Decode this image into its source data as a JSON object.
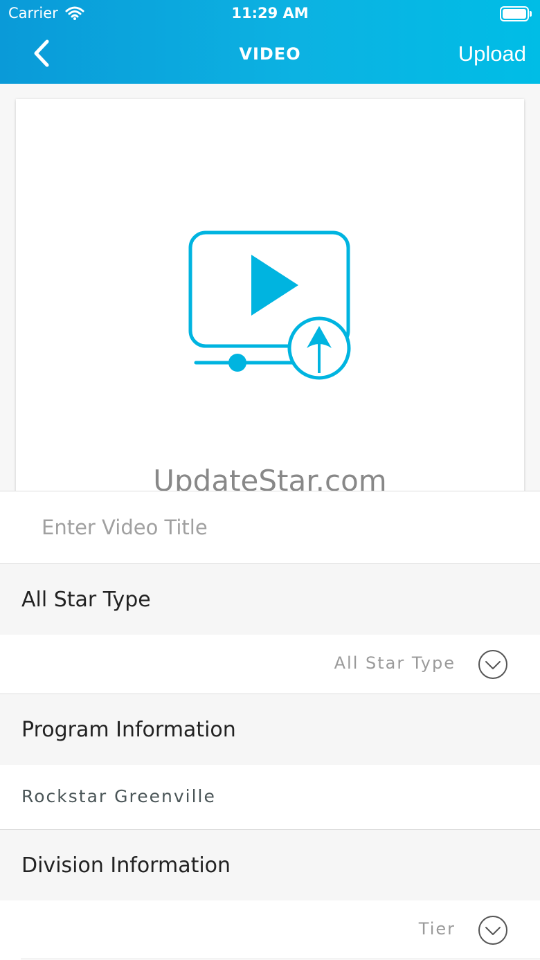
{
  "status_bar": {
    "carrier": "Carrier",
    "time": "11:29 AM"
  },
  "nav": {
    "title": "VIDEO",
    "upload_label": "Upload"
  },
  "video_card": {
    "icon": "video-upload-icon",
    "watermark": "UpdateStar.com"
  },
  "form": {
    "title_placeholder": "Enter Video Title",
    "all_star_type": {
      "label": "All Star Type",
      "picker_value": "All Star Type"
    },
    "program_information": {
      "label": "Program Information",
      "value": "Rockstar Greenville"
    },
    "division_information": {
      "label": "Division Information",
      "picker_value": "Tier"
    }
  },
  "colors": {
    "accent": "#00b4e0",
    "header_start": "#0a9ad8",
    "header_end": "#00bde6"
  }
}
